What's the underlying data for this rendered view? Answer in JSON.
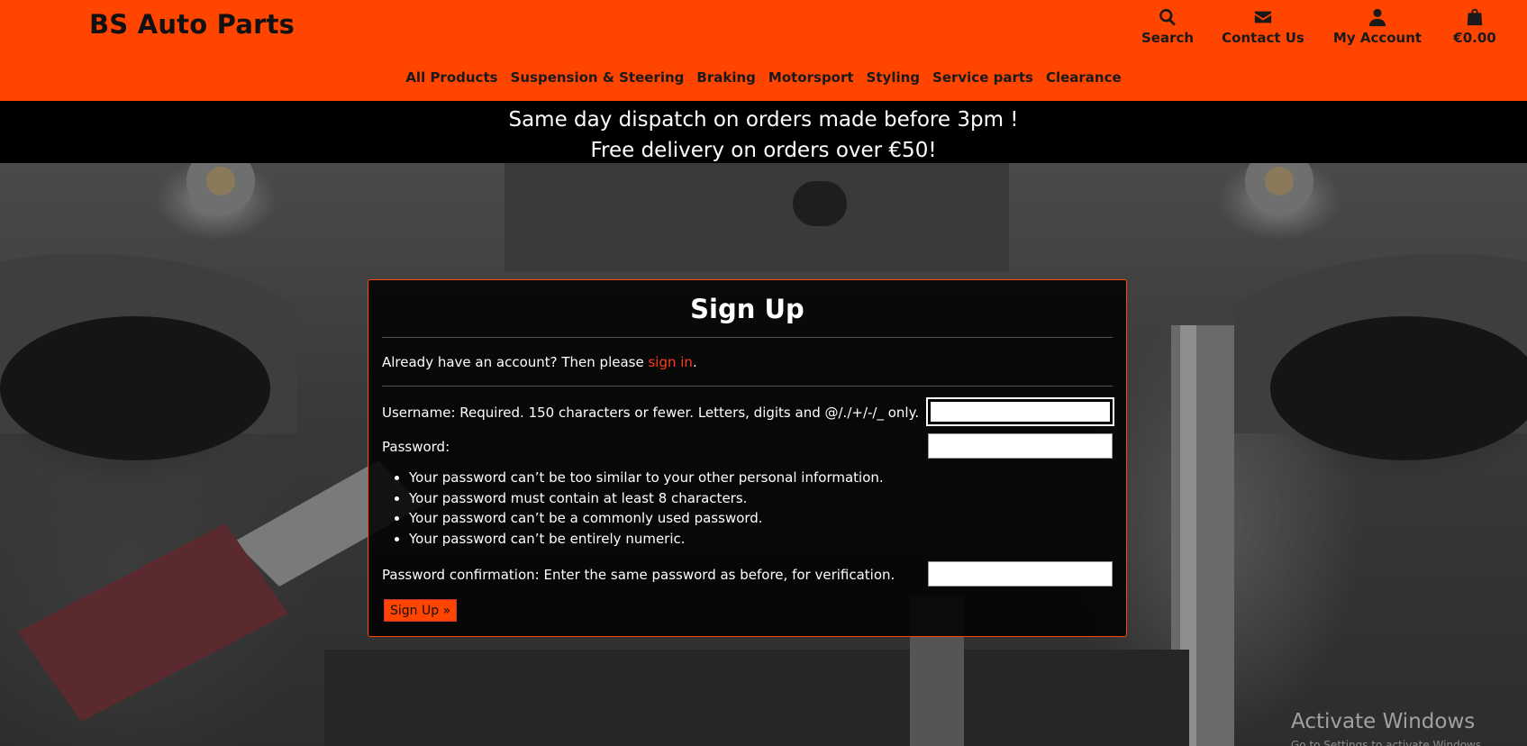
{
  "colors": {
    "brand_orange": "#ff4500",
    "banner_black": "#000000",
    "link_red": "#ff3b1f"
  },
  "header": {
    "brand": "BS Auto Parts",
    "top_links": [
      {
        "icon": "search-icon",
        "label": "Search"
      },
      {
        "icon": "envelope-icon",
        "label": "Contact Us"
      },
      {
        "icon": "user-icon",
        "label": "My Account"
      },
      {
        "icon": "shopping-bag-icon",
        "label": "€0.00"
      }
    ],
    "nav": [
      "All Products",
      "Suspension & Steering",
      "Braking",
      "Motorsport",
      "Styling",
      "Service parts",
      "Clearance"
    ]
  },
  "banner": {
    "line1": "Same day dispatch on orders made before 3pm !",
    "line2": "Free delivery on orders over €50!"
  },
  "signup": {
    "title": "Sign Up",
    "signin_prefix": "Already have an account? Then please ",
    "signin_link": "sign in",
    "signin_suffix": ".",
    "username_label": "Username: Required. 150 characters or fewer. Letters, digits and @/./+/-/_ only.",
    "username_value": "",
    "password_label": "Password:",
    "password_value": "",
    "password_rules": [
      "Your password can’t be too similar to your other personal information.",
      "Your password must contain at least 8 characters.",
      "Your password can’t be a commonly used password.",
      "Your password can’t be entirely numeric."
    ],
    "confirm_label": "Password confirmation: Enter the same password as before, for verification.",
    "confirm_value": "",
    "submit_label": "Sign Up »"
  },
  "watermark": {
    "title": "Activate Windows",
    "subtitle": "Go to Settings to activate Windows."
  }
}
